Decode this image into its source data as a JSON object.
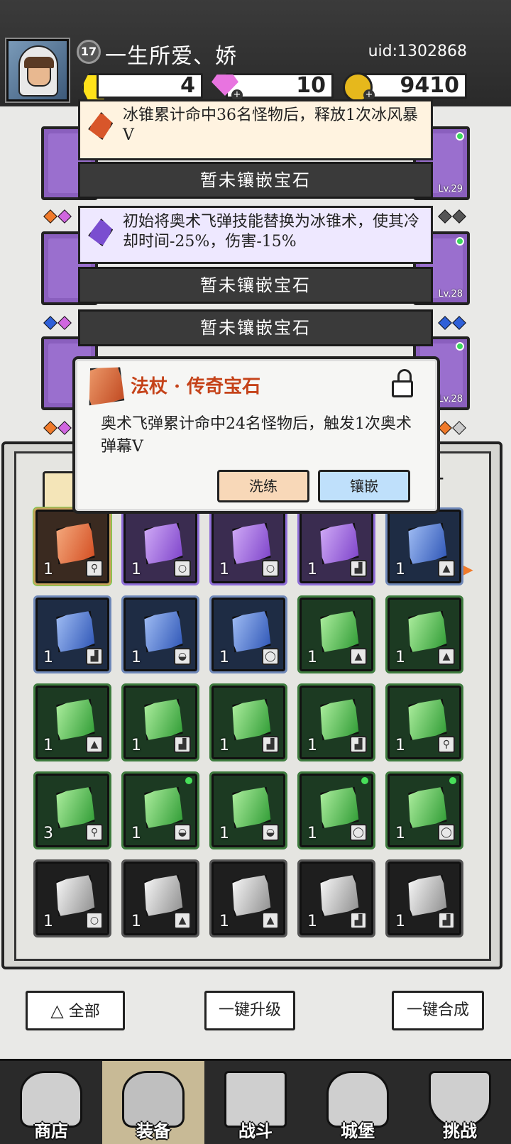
{
  "header": {
    "level": "17",
    "player_name": "一生所爱、娇",
    "uid": "uid:1302868",
    "currencies": [
      {
        "icon": "yellow-gem-icon",
        "value": "4"
      },
      {
        "icon": "diamond-icon",
        "value": "10"
      },
      {
        "icon": "gold-coin-icon",
        "value": "9410"
      }
    ]
  },
  "equipment": {
    "levels": [
      "Lv.29",
      "Lv.28",
      "Lv.28"
    ]
  },
  "gem_slots": {
    "slot1_desc": "冰锥累计命中36名怪物后，释放1次冰风暴V",
    "slot2_label": "暂未镶嵌宝石",
    "slot3_desc": "初始将奥术飞弹技能替换为冰锥术，使其冷却时间-25%，伤害-15%",
    "slot4_label": "暂未镶嵌宝石",
    "slot5_label": "暂未镶嵌宝石"
  },
  "popup": {
    "title": "法杖 · 传奇宝石",
    "description": "奥术飞弹累计命中24名怪物后，触发1次奥术弹幕V",
    "refine_label": "洗练",
    "inlay_label": "镶嵌"
  },
  "bag": {
    "filter_plus": "+",
    "items": [
      {
        "rarity": "orange",
        "count": "1",
        "slot": "staff-icon",
        "selected": true,
        "dot": false
      },
      {
        "rarity": "purple",
        "count": "1",
        "slot": "ring-icon",
        "selected": false,
        "dot": false
      },
      {
        "rarity": "purple",
        "count": "1",
        "slot": "ring-icon",
        "selected": false,
        "dot": false
      },
      {
        "rarity": "purple",
        "count": "1",
        "slot": "boots-icon",
        "selected": false,
        "dot": false
      },
      {
        "rarity": "blue",
        "count": "1",
        "slot": "armor-icon",
        "selected": false,
        "dot": false
      },
      {
        "rarity": "blue",
        "count": "1",
        "slot": "boots-icon",
        "selected": false,
        "dot": false
      },
      {
        "rarity": "blue",
        "count": "1",
        "slot": "helmet-icon",
        "selected": false,
        "dot": false
      },
      {
        "rarity": "blue",
        "count": "1",
        "slot": "necklace-icon",
        "selected": false,
        "dot": false
      },
      {
        "rarity": "green",
        "count": "1",
        "slot": "armor-icon",
        "selected": false,
        "dot": false
      },
      {
        "rarity": "green",
        "count": "1",
        "slot": "armor-icon",
        "selected": false,
        "dot": false
      },
      {
        "rarity": "green",
        "count": "1",
        "slot": "armor-icon",
        "selected": false,
        "dot": false
      },
      {
        "rarity": "green",
        "count": "1",
        "slot": "boots-icon",
        "selected": false,
        "dot": false
      },
      {
        "rarity": "green",
        "count": "1",
        "slot": "boots-icon",
        "selected": false,
        "dot": false
      },
      {
        "rarity": "green",
        "count": "1",
        "slot": "boots-icon",
        "selected": false,
        "dot": false
      },
      {
        "rarity": "green",
        "count": "1",
        "slot": "staff-icon",
        "selected": false,
        "dot": false
      },
      {
        "rarity": "green",
        "count": "3",
        "slot": "staff-icon",
        "selected": false,
        "dot": false
      },
      {
        "rarity": "green",
        "count": "1",
        "slot": "helmet-icon",
        "selected": false,
        "dot": true
      },
      {
        "rarity": "green",
        "count": "1",
        "slot": "helmet-icon",
        "selected": false,
        "dot": false
      },
      {
        "rarity": "green",
        "count": "1",
        "slot": "necklace-icon",
        "selected": false,
        "dot": true
      },
      {
        "rarity": "green",
        "count": "1",
        "slot": "necklace-icon",
        "selected": false,
        "dot": true
      },
      {
        "rarity": "gray",
        "count": "1",
        "slot": "ring-icon",
        "selected": false,
        "dot": false
      },
      {
        "rarity": "gray",
        "count": "1",
        "slot": "armor-icon",
        "selected": false,
        "dot": false
      },
      {
        "rarity": "gray",
        "count": "1",
        "slot": "armor-icon",
        "selected": false,
        "dot": false
      },
      {
        "rarity": "gray",
        "count": "1",
        "slot": "boots-icon",
        "selected": false,
        "dot": false
      },
      {
        "rarity": "gray",
        "count": "1",
        "slot": "boots-icon",
        "selected": false,
        "dot": false
      }
    ]
  },
  "actions": {
    "all_label": "全部",
    "upgrade_label": "一键升级",
    "merge_label": "一键合成"
  },
  "nav": {
    "items": [
      {
        "label": "商店",
        "icon": "shop-icon",
        "active": false
      },
      {
        "label": "装备",
        "icon": "backpack-icon",
        "active": true
      },
      {
        "label": "战斗",
        "icon": "crossed-swords-icon",
        "active": false
      },
      {
        "label": "城堡",
        "icon": "castle-icon",
        "active": false
      },
      {
        "label": "挑战",
        "icon": "shield-icon",
        "active": false
      }
    ]
  }
}
